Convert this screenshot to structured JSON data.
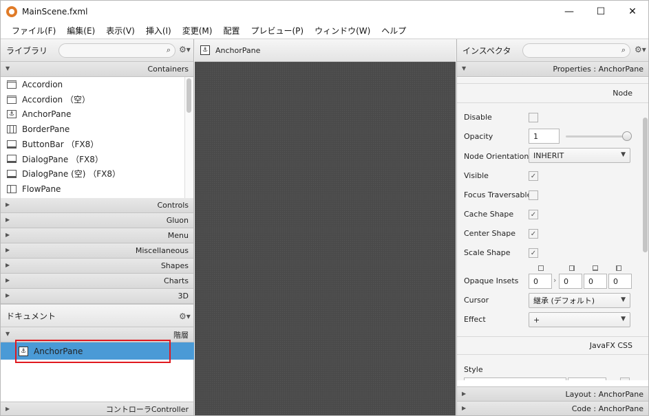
{
  "window": {
    "title": "MainScene.fxml",
    "minimize": "—",
    "maximize": "☐",
    "close": "✕"
  },
  "menu": [
    "ファイル(F)",
    "編集(E)",
    "表示(V)",
    "挿入(I)",
    "変更(M)",
    "配置",
    "プレビュー(P)",
    "ウィンドウ(W)",
    "ヘルプ"
  ],
  "library": {
    "title": "ライブラリ",
    "open_section": "Containers",
    "items": [
      "Accordion",
      "Accordion （空）",
      "AnchorPane",
      "BorderPane",
      "ButtonBar （FX8）",
      "DialogPane （FX8）",
      "DialogPane (空) （FX8）",
      "FlowPane"
    ],
    "sections": [
      "Controls",
      "Gluon",
      "Menu",
      "Miscellaneous",
      "Shapes",
      "Charts",
      "3D"
    ]
  },
  "document": {
    "title": "ドキュメント",
    "section": "階層",
    "tree_item": "AnchorPane",
    "footer": "コントローラController"
  },
  "center": {
    "header": "AnchorPane"
  },
  "inspector": {
    "title": "インスペクタ",
    "properties_section": "Properties : AnchorPane",
    "node_label": "Node",
    "fields": {
      "disable": "Disable",
      "opacity": "Opacity",
      "opacity_value": "1",
      "node_orientation": "Node Orientation",
      "node_orientation_value": "INHERIT",
      "visible": "Visible",
      "focus_traversable": "Focus Traversable",
      "cache_shape": "Cache Shape",
      "center_shape": "Center Shape",
      "scale_shape": "Scale Shape",
      "opaque_insets": "Opaque Insets",
      "insets_values": [
        "0",
        "0",
        "0",
        "0"
      ],
      "cursor": "Cursor",
      "cursor_value": "継承 (デフォルト)",
      "effect": "Effect",
      "effect_value": "+"
    },
    "css_label": "JavaFX CSS",
    "style_label": "Style",
    "layout_section": "Layout : AnchorPane",
    "code_section": "Code : AnchorPane"
  }
}
